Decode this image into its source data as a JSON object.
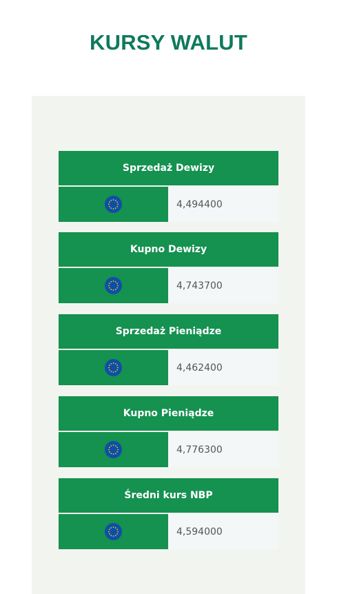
{
  "page": {
    "title": "KURSY WALUT"
  },
  "icons": {
    "currency_flag": "eu-flag-icon"
  },
  "colors": {
    "accent": "#159150",
    "title": "#0f7a5b",
    "panel": "#f2f5ef",
    "value_bg": "#f4f7f8"
  },
  "rates": [
    {
      "label": "Sprzedaż Dewizy",
      "value": "4,494400"
    },
    {
      "label": "Kupno Dewizy",
      "value": "4,743700"
    },
    {
      "label": "Sprzedaż Pieniądze",
      "value": "4,462400"
    },
    {
      "label": "Kupno Pieniądze",
      "value": "4,776300"
    },
    {
      "label": "Średni kurs NBP",
      "value": "4,594000"
    }
  ]
}
